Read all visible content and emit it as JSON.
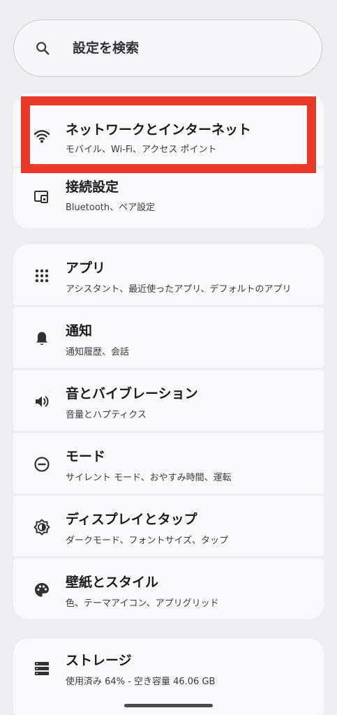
{
  "search": {
    "placeholder": "設定を検索",
    "icon": "search-icon"
  },
  "groups": [
    {
      "items": [
        {
          "title": "ネットワークとインターネット",
          "subtitle": "モバイル、Wi-Fi、アクセス ポイント",
          "icon": "wifi-icon",
          "highlighted": true
        },
        {
          "title": "接続設定",
          "subtitle": "Bluetooth、ペア設定",
          "icon": "connected-devices-icon"
        }
      ]
    },
    {
      "items": [
        {
          "title": "アプリ",
          "subtitle": "アシスタント、最近使ったアプリ、デフォルトのアプリ",
          "icon": "apps-grid-icon"
        },
        {
          "title": "通知",
          "subtitle": "通知履歴、会話",
          "icon": "bell-icon"
        },
        {
          "title": "音とバイブレーション",
          "subtitle": "音量とハプティクス",
          "icon": "volume-icon"
        },
        {
          "title": "モード",
          "subtitle": "サイレント モード、おやすみ時間、運転",
          "icon": "do-not-disturb-icon"
        },
        {
          "title": "ディスプレイとタップ",
          "subtitle": "ダークモード、フォントサイズ、タップ",
          "icon": "brightness-icon"
        },
        {
          "title": "壁紙とスタイル",
          "subtitle": "色、テーマアイコン、アプリグリッド",
          "icon": "palette-icon"
        }
      ]
    },
    {
      "items": [
        {
          "title": "ストレージ",
          "subtitle": "使用済み 64% - 空き容量 46.06 GB",
          "icon": "storage-icon"
        }
      ]
    }
  ],
  "colors": {
    "background": "#eeedf2",
    "card": "#f9f9fb",
    "highlight_border": "#e8392b"
  }
}
